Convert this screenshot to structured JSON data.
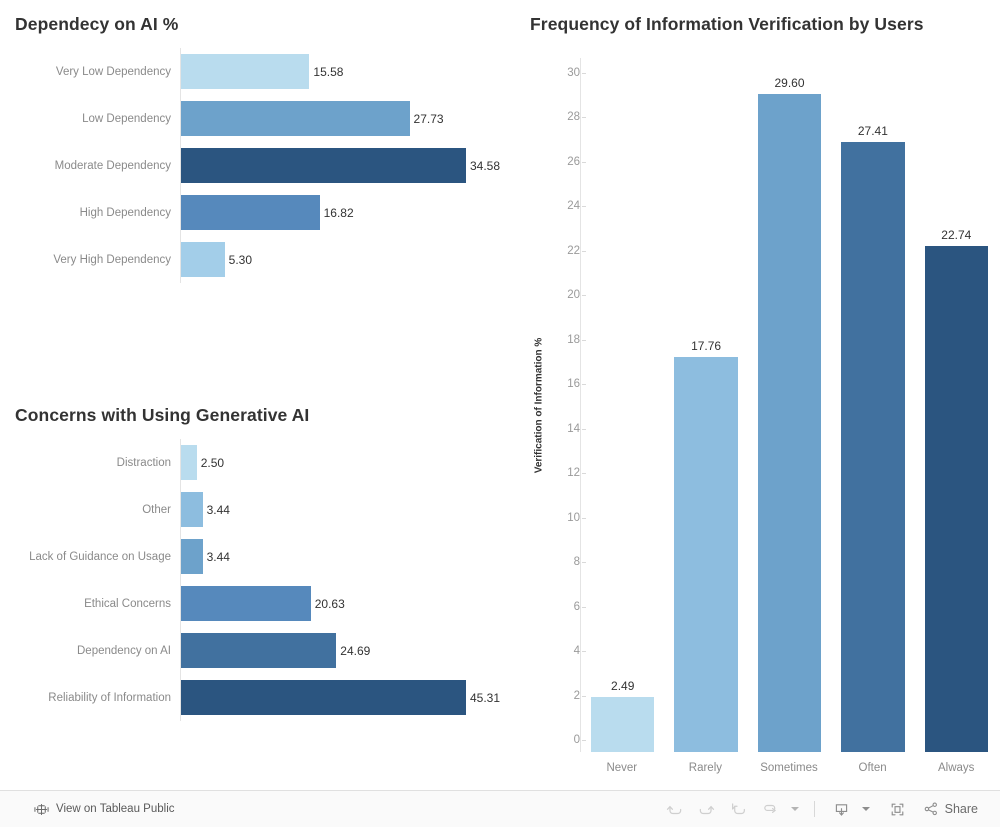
{
  "chart_data": [
    {
      "type": "bar",
      "orientation": "horizontal",
      "title": "Dependecy on AI %",
      "xlabel": "",
      "ylabel": "",
      "grid": false,
      "legend": "none",
      "xlim": [
        0,
        34.58
      ],
      "categories": [
        "Very Low Dependency",
        "Low Dependency",
        "Moderate Dependency",
        "High Dependency",
        "Very High Dependency"
      ],
      "values": [
        15.58,
        27.73,
        34.58,
        16.82,
        5.3
      ],
      "value_labels": [
        "15.58",
        "27.73",
        "34.58",
        "16.82",
        "5.30"
      ],
      "colors": [
        "#b9dcee",
        "#6da2cb",
        "#2b5580",
        "#5689bc",
        "#a3cee9"
      ]
    },
    {
      "type": "bar",
      "orientation": "horizontal",
      "title": "Concerns with Using Generative AI",
      "xlabel": "",
      "ylabel": "",
      "grid": false,
      "legend": "none",
      "xlim": [
        0,
        45.31
      ],
      "categories": [
        "Distraction",
        "Other",
        "Lack of Guidance on Usage",
        "Ethical Concerns",
        "Dependency on AI",
        "Reliability of Information"
      ],
      "values": [
        2.5,
        3.44,
        3.44,
        20.63,
        24.69,
        45.31
      ],
      "value_labels": [
        "2.50",
        "3.44",
        "3.44",
        "20.63",
        "24.69",
        "45.31"
      ],
      "colors": [
        "#b9dcee",
        "#8dbddf",
        "#6da2cb",
        "#5689bc",
        "#41719f",
        "#2b5580"
      ]
    },
    {
      "type": "bar",
      "orientation": "vertical",
      "title": "Frequency of Information Verification by Users",
      "xlabel": "",
      "ylabel": "Verification of Information %",
      "grid": false,
      "legend": "none",
      "ylim": [
        0,
        31.2
      ],
      "yticks": [
        0,
        2,
        4,
        6,
        8,
        10,
        12,
        14,
        16,
        18,
        20,
        22,
        24,
        26,
        28,
        30
      ],
      "ytick_labels": [
        "0",
        "2",
        "4",
        "6",
        "8",
        "10",
        "12",
        "14",
        "16",
        "18",
        "20",
        "22",
        "24",
        "26",
        "28",
        "30"
      ],
      "categories": [
        "Never",
        "Rarely",
        "Sometimes",
        "Often",
        "Always"
      ],
      "values": [
        2.49,
        17.76,
        29.6,
        27.41,
        22.74
      ],
      "value_labels": [
        "2.49",
        "17.76",
        "29.60",
        "27.41",
        "22.74"
      ],
      "colors": [
        "#b9dcee",
        "#8dbddf",
        "#6da2cb",
        "#41719f",
        "#2b5580"
      ]
    }
  ],
  "toolbar": {
    "view_on_tableau_public": "View on Tableau Public",
    "tableau_logo_icon": "tableau-logo-icon",
    "undo_icon": "undo-icon",
    "redo_icon": "redo-icon",
    "revert_icon": "revert-icon",
    "refresh_icon": "refresh-icon",
    "refresh_caret_icon": "chevron-down-icon",
    "download_icon": "download-icon",
    "download_caret_icon": "chevron-down-icon",
    "fullscreen_icon": "fullscreen-icon",
    "share_icon": "share-icon",
    "share_label": "Share"
  },
  "theme": {
    "background": "#ffffff",
    "toolbar_background": "#fafafa",
    "title_color": "#333333",
    "label_color": "#8a8a8a",
    "axis_line_color": "#e4e4e4"
  }
}
